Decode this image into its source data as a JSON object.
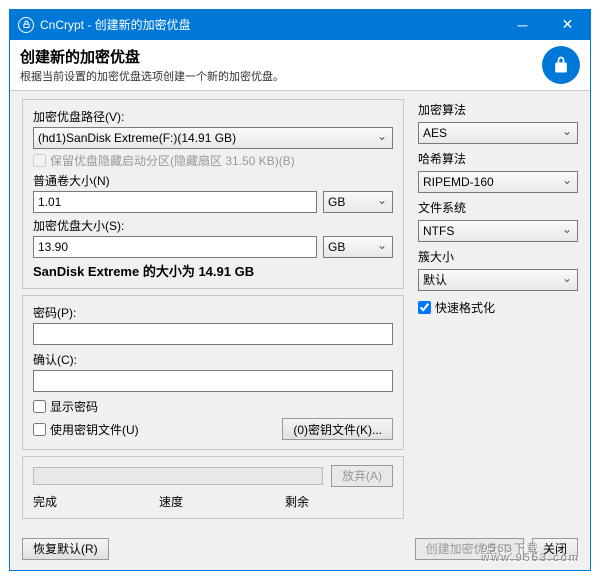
{
  "title": "CnCrypt - 创建新的加密优盘",
  "header": {
    "heading": "创建新的加密优盘",
    "sub": "根据当前设置的加密优盘选项创建一个新的加密优盘。"
  },
  "left": {
    "pathLabel": "加密优盘路径(V):",
    "pathValue": "(hd1)SanDisk Extreme(F:)(14.91 GB)",
    "reserveLabel": "保留优盘隐藏启动分区(隐藏扇区 31.50 KB)(B)",
    "normalSizeLabel": "普通卷大小(N)",
    "normalSizeValue": "1.01",
    "unitGB": "GB",
    "encSizeLabel": "加密优盘大小(S):",
    "encSizeValue": "13.90",
    "sizeNote": "SanDisk Extreme 的大小为 14.91 GB",
    "pwdLabel": "密码(P):",
    "confirmLabel": "确认(C):",
    "showPwd": "显示密码",
    "useKeyfile": "使用密钥文件(U)",
    "keyfileBtn": "(0)密钥文件(K)..."
  },
  "right": {
    "algoLabel": "加密算法",
    "algoValue": "AES",
    "hashLabel": "哈希算法",
    "hashValue": "RIPEMD-160",
    "fsLabel": "文件系统",
    "fsValue": "NTFS",
    "clusterLabel": "簇大小",
    "clusterValue": "默认",
    "quickFormat": "快速格式化"
  },
  "progress": {
    "abandon": "放弃(A)",
    "doneLabel": "完成",
    "speedLabel": "速度",
    "remainLabel": "剩余"
  },
  "footer": {
    "restore": "恢复默认(R)",
    "create": "创建加密优盘(T)",
    "close": "关闭"
  },
  "watermark": {
    "main": "9553下载",
    "sub": "www.9553.com"
  }
}
